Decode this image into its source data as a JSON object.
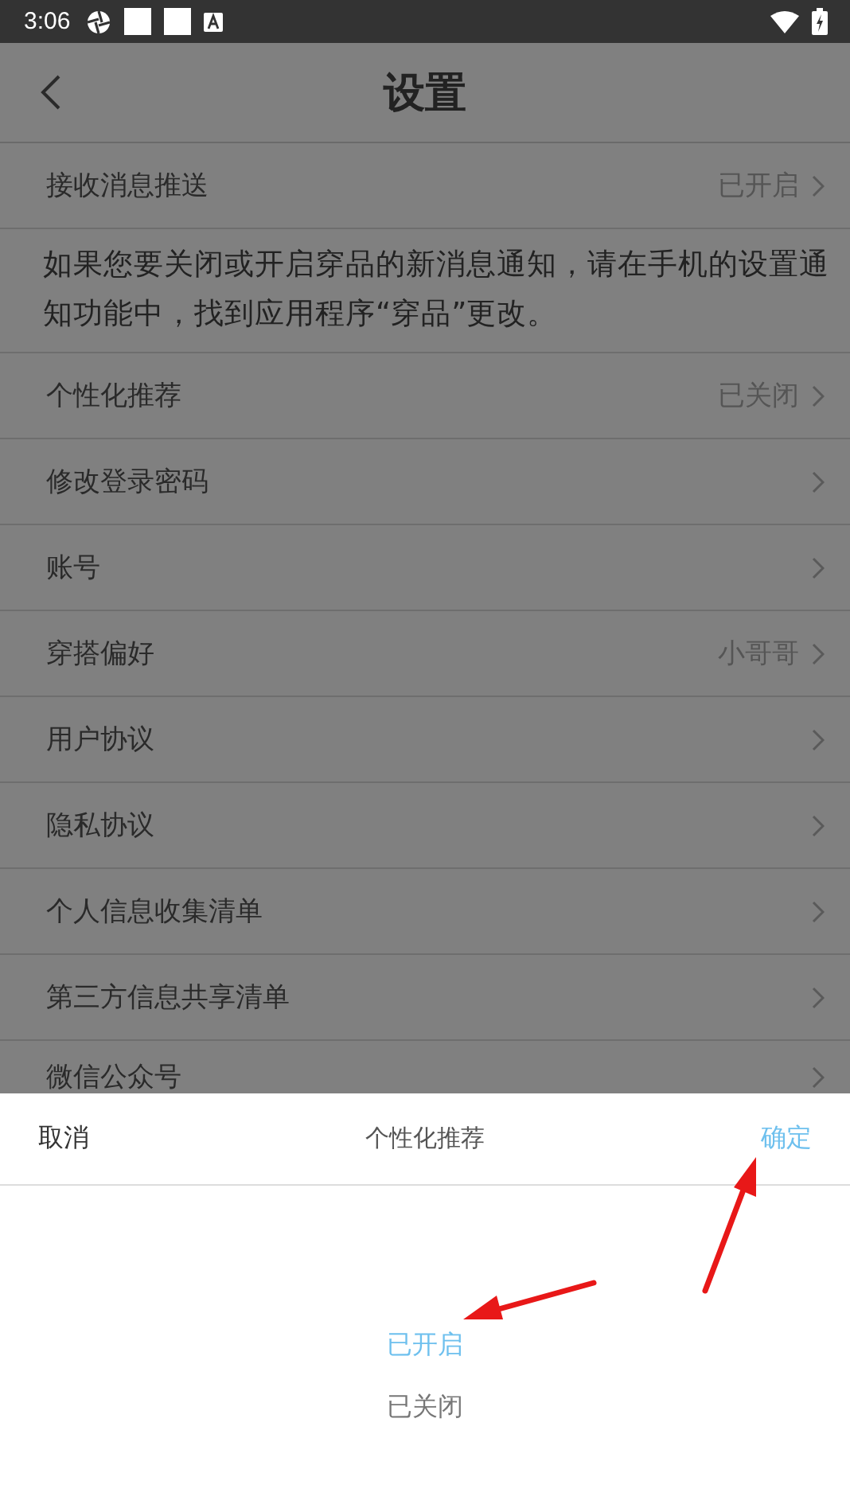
{
  "status_bar": {
    "time": "3:06"
  },
  "header": {
    "title": "设置"
  },
  "rows": [
    {
      "kind": "item",
      "label": "接收消息推送",
      "value": "已开启"
    },
    {
      "kind": "notice",
      "label": "如果您要关闭或开启穿品的新消息通知，请在手机的设置通知功能中，找到应用程序“穿品”更改。"
    },
    {
      "kind": "item",
      "label": "个性化推荐",
      "value": "已关闭"
    },
    {
      "kind": "item",
      "label": "修改登录密码"
    },
    {
      "kind": "item",
      "label": "账号"
    },
    {
      "kind": "item",
      "label": "穿搭偏好",
      "value": "小哥哥"
    },
    {
      "kind": "item",
      "label": "用户协议"
    },
    {
      "kind": "item",
      "label": "隐私协议"
    },
    {
      "kind": "item",
      "label": "个人信息收集清单"
    },
    {
      "kind": "item",
      "label": "第三方信息共享清单"
    },
    {
      "kind": "item",
      "label": "微信公众号"
    }
  ],
  "picker": {
    "cancel": "取消",
    "title": "个性化推荐",
    "confirm": "确定",
    "options": [
      {
        "label": "已开启",
        "selected": true
      },
      {
        "label": "已关闭",
        "selected": false
      }
    ]
  }
}
